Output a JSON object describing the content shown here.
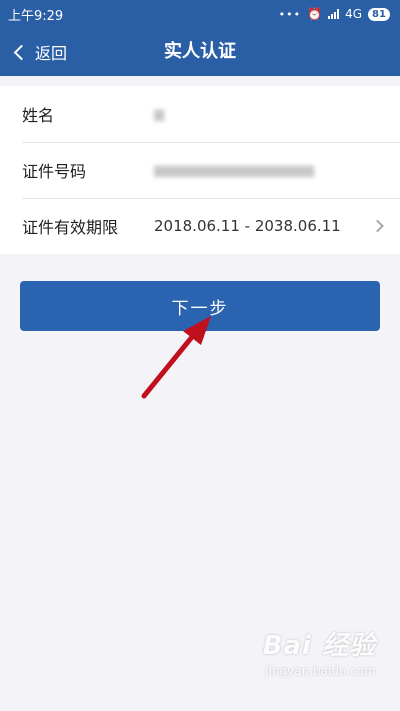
{
  "status_bar": {
    "time": "上午9:29",
    "network": "4G",
    "battery": "81"
  },
  "nav": {
    "back_label": "返回",
    "title": "实人认证"
  },
  "info_rows": [
    {
      "label": "姓名",
      "value": ""
    },
    {
      "label": "证件号码",
      "value": ""
    },
    {
      "label": "证件有效期限",
      "value": "2018.06.11 - 2038.06.11"
    }
  ],
  "next_button_label": "下一步",
  "watermark": {
    "brand": "Bai 经验",
    "site": "jingyan.baidu.com"
  },
  "colors": {
    "header": "#2a5fa6",
    "button": "#2a63b0",
    "background": "#f3f3f8",
    "annotation_arrow": "#c0101e"
  }
}
